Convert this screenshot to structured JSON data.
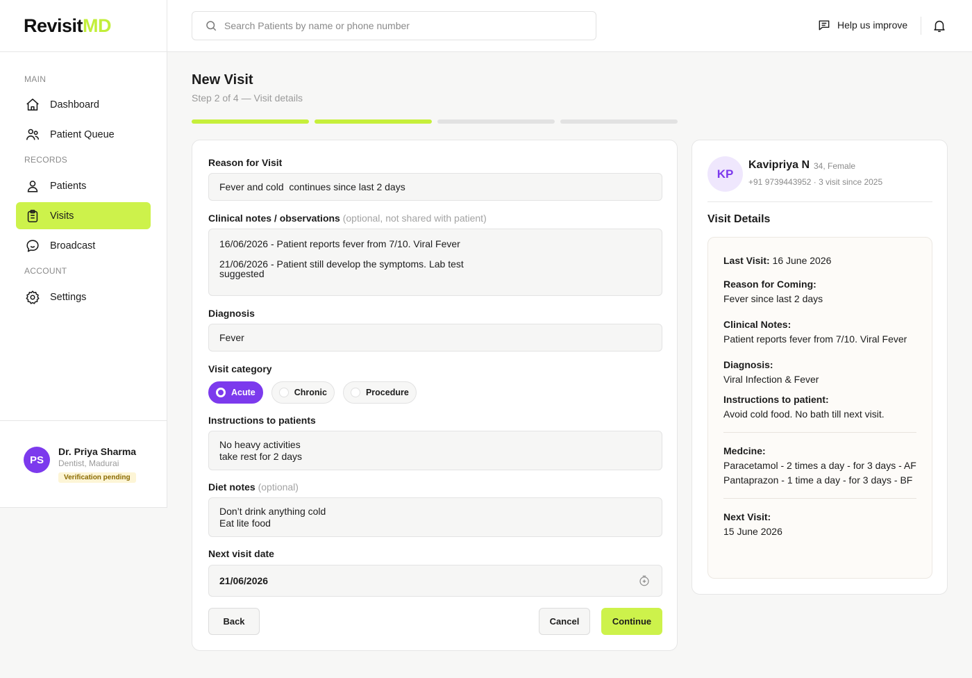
{
  "app": {
    "logo_main": "Revisit",
    "logo_accent": "MD"
  },
  "sidebar": {
    "sections": [
      "MAIN",
      "RECORDS",
      "ACCOUNT"
    ],
    "items": [
      {
        "label": "Dashboard",
        "icon": "home-icon"
      },
      {
        "label": "Patient Queue",
        "icon": "users-icon"
      },
      {
        "label": "Patients",
        "icon": "user-icon"
      },
      {
        "label": "Visits",
        "icon": "clipboard-icon",
        "active": true
      },
      {
        "label": "Broadcast",
        "icon": "chat-icon"
      },
      {
        "label": "Settings",
        "icon": "gear-icon"
      }
    ],
    "user": {
      "initials": "PS",
      "name": "Dr. Priya Sharma",
      "role": "Dentist, Madurai",
      "badge": "Verification pending"
    }
  },
  "topbar": {
    "search_placeholder": "Search Patients by name or phone number",
    "help_label": "Help us improve"
  },
  "page": {
    "title": "New Visit",
    "subtitle": "Step 2 of 4 — Visit details",
    "steps_completed": 2,
    "steps_total": 4
  },
  "form": {
    "reason_label": "Reason for Visit",
    "reason_value": "Fever and cold  continues since last 2 days",
    "notes_label": "Clinical notes / observations",
    "notes_hint": "(optional, not shared with patient)",
    "notes_line1": "16/06/2026 - Patient reports fever from 7/10. Viral Fever",
    "notes_line2": "21/06/2026 - Patient still develop the symptoms. Lab test suggested",
    "diagnosis_label": "Diagnosis",
    "diagnosis_value": "Fever",
    "category_label": "Visit category",
    "categories": [
      {
        "label": "Acute",
        "selected": true
      },
      {
        "label": "Chronic",
        "selected": false
      },
      {
        "label": "Procedure",
        "selected": false
      }
    ],
    "instructions_label": "Instructions to patients",
    "instructions_line1": "No heavy activities",
    "instructions_line2": "take rest for 2 days",
    "diet_label": "Diet notes",
    "diet_hint": "(optional)",
    "diet_line1": "Don’t drink anything cold",
    "diet_line2": "Eat lite food",
    "next_date_label": "Next visit date",
    "next_date_value": "21/06/2026",
    "back_label": "Back",
    "cancel_label": "Cancel",
    "continue_label": "Continue"
  },
  "patient": {
    "initials": "KP",
    "name": "Kavipriya N",
    "meta": "34, Female",
    "phone_line": "+91 9739443952 · 3 visit since 2025",
    "details_title": "Visit Details",
    "last_visit_label": "Last Visit:",
    "last_visit_value": "16 June 2026",
    "reason_label": "Reason for Coming:",
    "reason_value": "Fever since last 2 days",
    "notes_label": "Clinical Notes:",
    "notes_value": "Patient reports fever from 7/10. Viral Fever",
    "diagnosis_label": "Diagnosis:",
    "diagnosis_value": "Viral Infection & Fever",
    "instructions_label": "Instructions to patient:",
    "instructions_value": "Avoid cold food. No bath till next visit.",
    "medicine_label": "Medcine:",
    "medicine_1": "Paracetamol - 2 times a day - for 3 days - AF",
    "medicine_2": "Pantaprazon - 1 time a day - for 3 days - BF",
    "next_visit_label": "Next Visit:",
    "next_visit_value": "15 June 2026"
  },
  "colors": {
    "accent_lime": "#cdf24b",
    "accent_purple": "#7c3aed"
  }
}
